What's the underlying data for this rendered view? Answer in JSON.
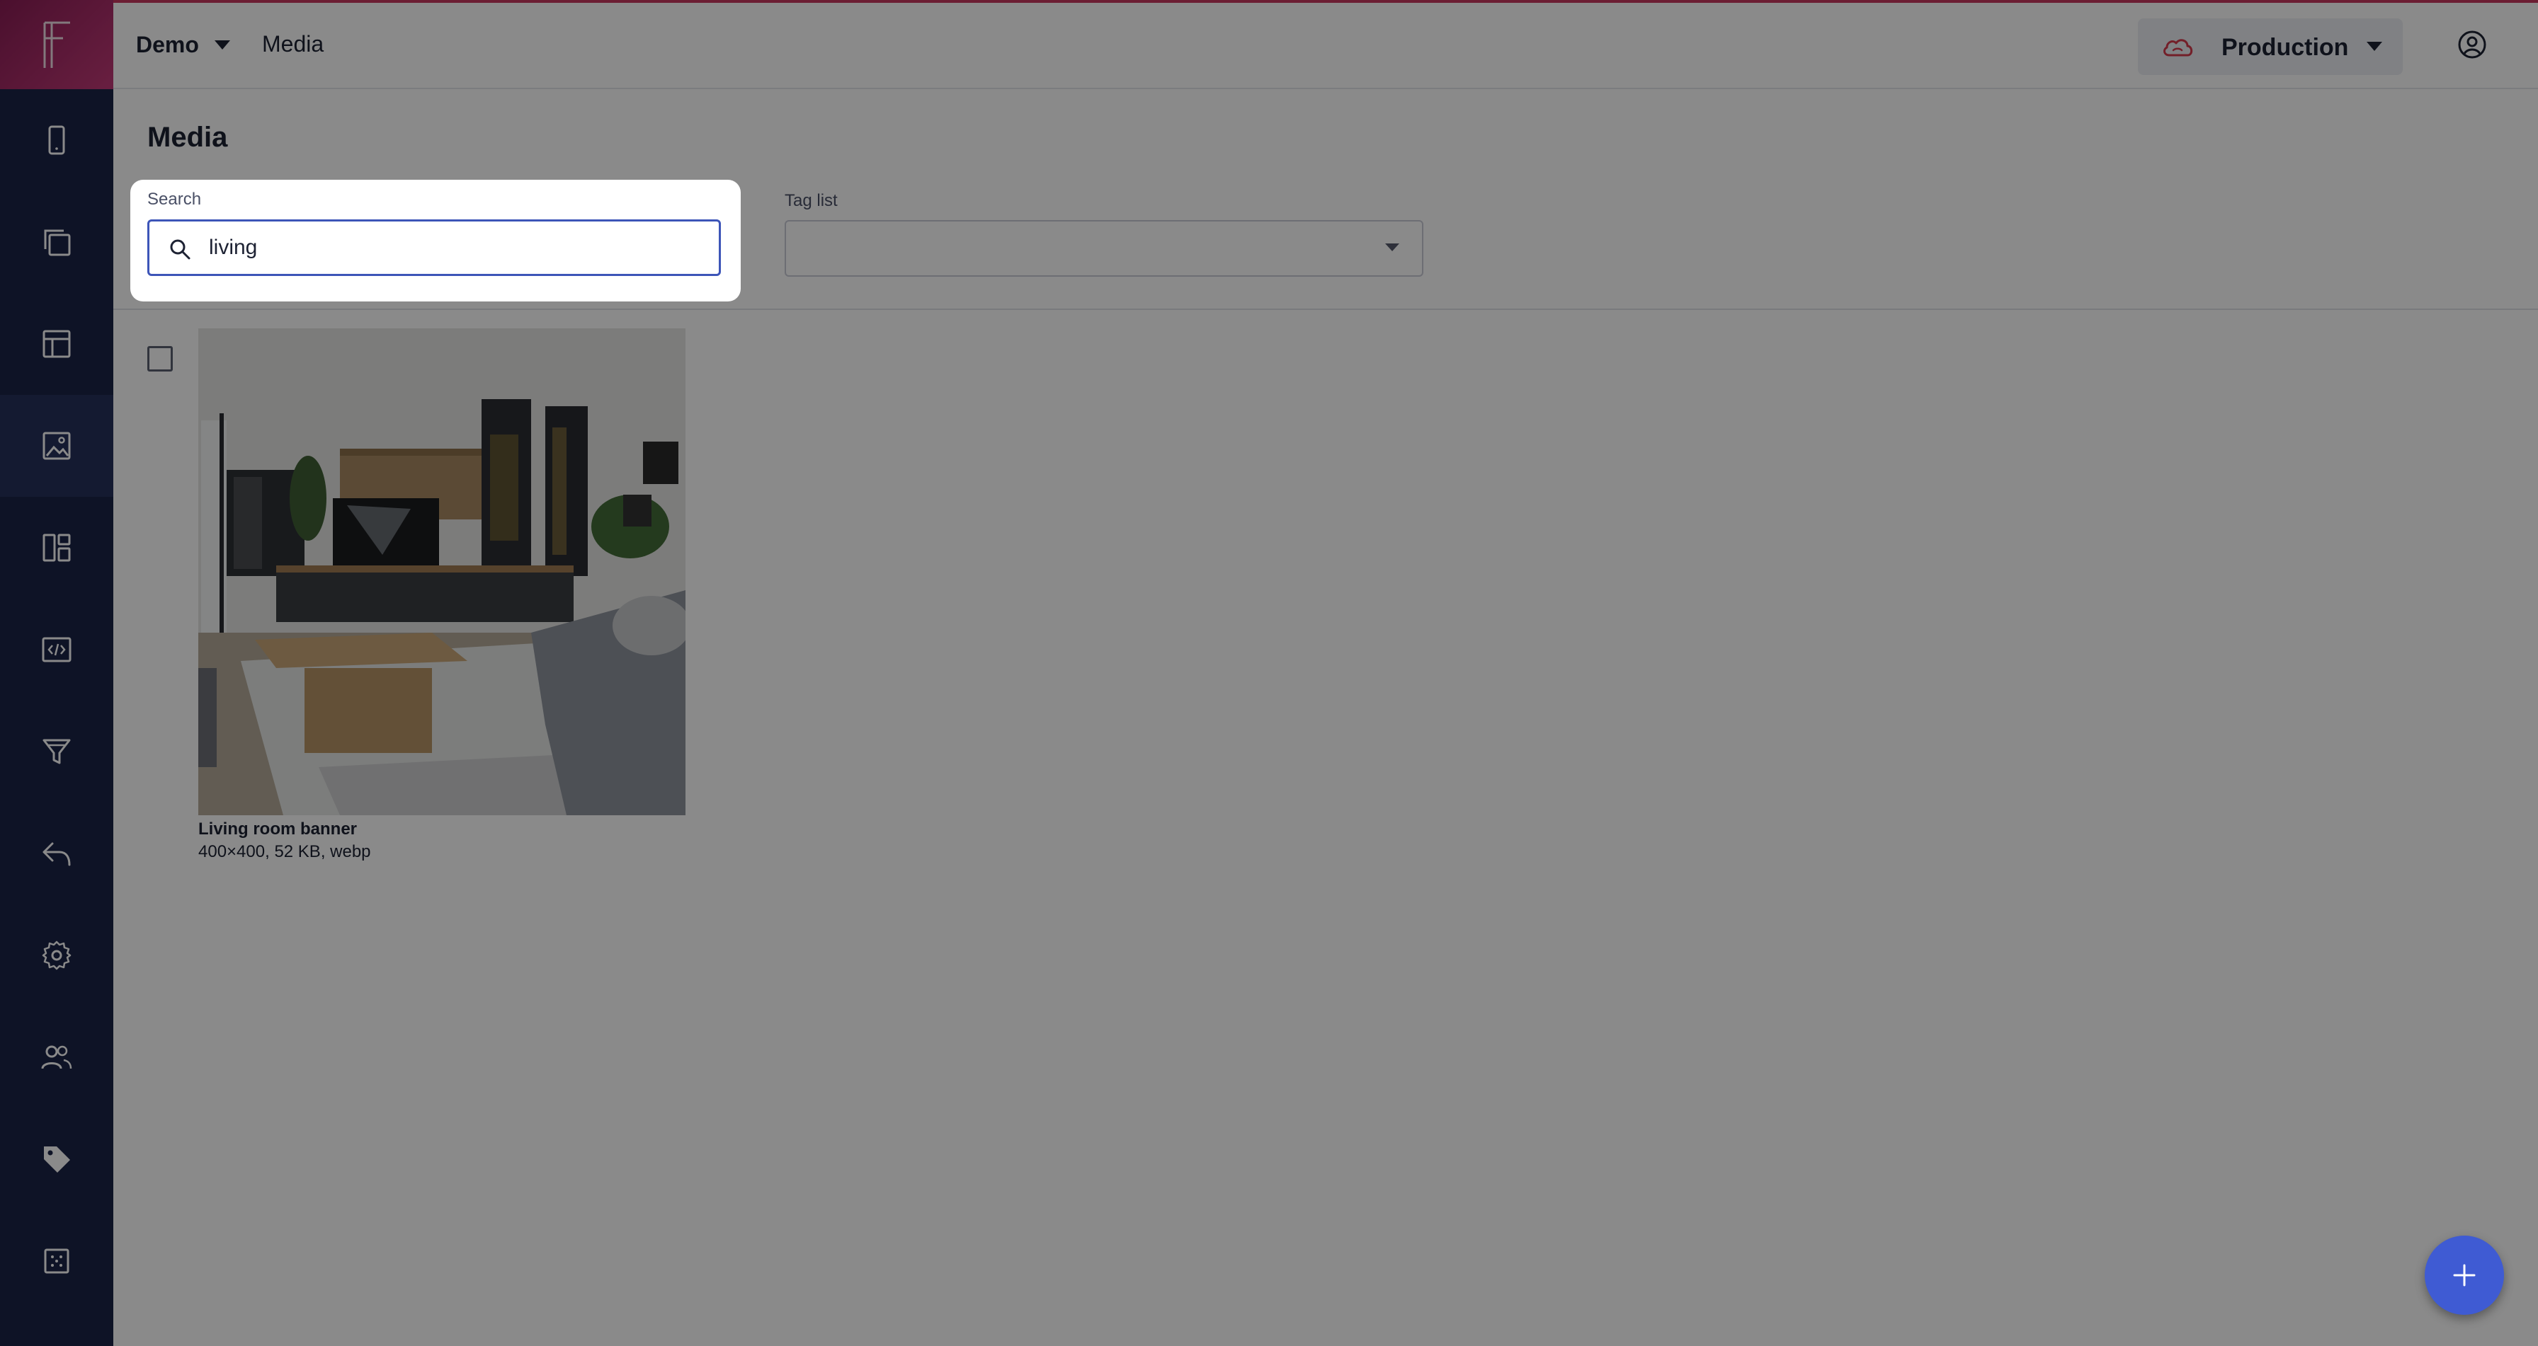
{
  "app": {
    "logo_letter": "F"
  },
  "header": {
    "project": "Demo",
    "breadcrumb": "Media",
    "environment": "Production"
  },
  "sidebar": {
    "items": [
      {
        "icon": "mobile-icon"
      },
      {
        "icon": "copy-pages-icon"
      },
      {
        "icon": "layout-icon"
      },
      {
        "icon": "image-icon",
        "active": true
      },
      {
        "icon": "dashboard-icon"
      },
      {
        "icon": "code-icon"
      },
      {
        "icon": "filter-icon"
      },
      {
        "icon": "reply-icon"
      },
      {
        "icon": "gear-icon"
      },
      {
        "icon": "users-icon"
      },
      {
        "icon": "tag-icon"
      },
      {
        "icon": "grid-icon"
      }
    ]
  },
  "main": {
    "title": "Media",
    "search": {
      "label": "Search",
      "value": "living"
    },
    "tag_list": {
      "label": "Tag list",
      "value": ""
    },
    "media": [
      {
        "name": "Living room banner",
        "meta": "400×400, 52 KB, webp",
        "checked": false
      }
    ]
  },
  "colors": {
    "sidebar": "#1a2347",
    "accent": "#3f5bd3",
    "brand": "#c23a78",
    "environment_icon": "#d43a4c"
  }
}
